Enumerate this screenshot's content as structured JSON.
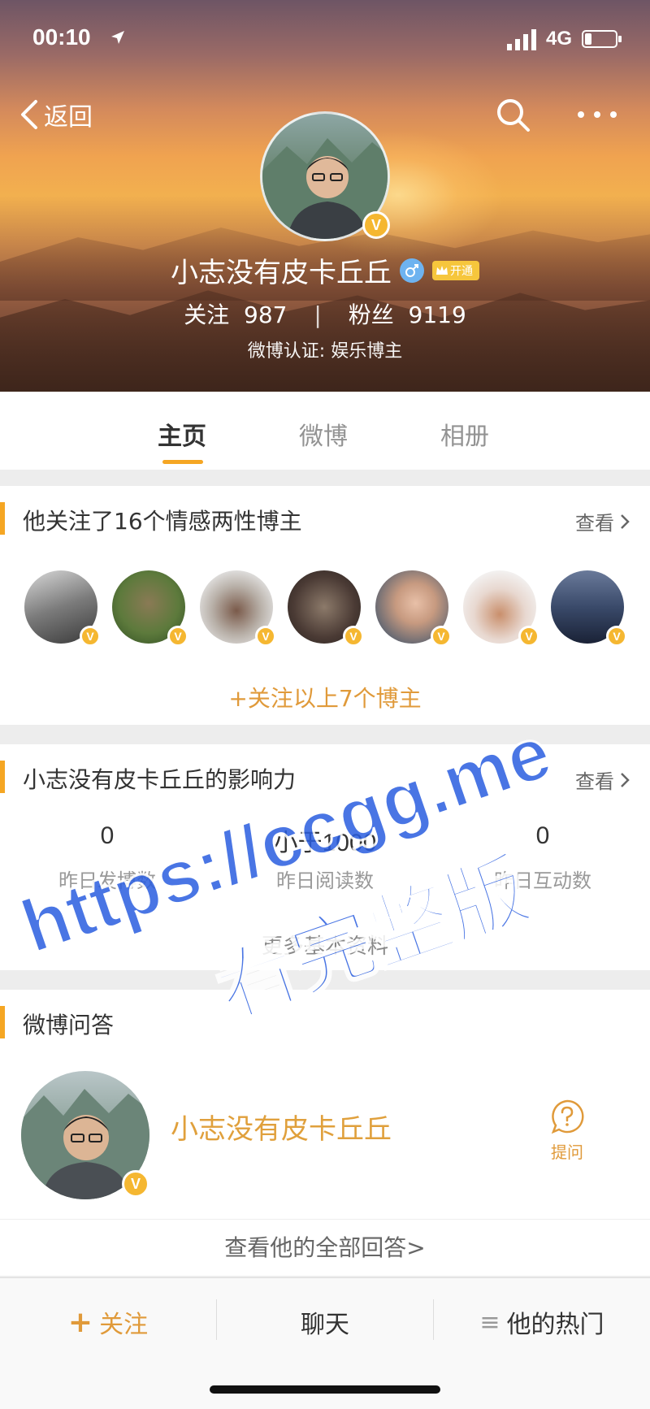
{
  "status_bar": {
    "time": "00:10",
    "network": "4G"
  },
  "nav": {
    "back_label": "返回",
    "search_icon": "search-icon",
    "more_icon": "more-icon"
  },
  "profile": {
    "name": "小志没有皮卡丘丘",
    "vip_label": "开通",
    "following_label": "关注",
    "following_count": "987",
    "fans_label": "粉丝",
    "fans_count": "9119",
    "stats_separator": "|",
    "verification": "微博认证: 娱乐博主",
    "verified_badge": "V"
  },
  "tabs": [
    {
      "label": "主页",
      "active": true
    },
    {
      "label": "微博",
      "active": false
    },
    {
      "label": "相册",
      "active": false
    }
  ],
  "follow_card": {
    "title": "他关注了16个情感两性博主",
    "see_more": "查看",
    "follow_all": "+关注以上7个博主"
  },
  "influence_card": {
    "title": "小志没有皮卡丘丘的影响力",
    "see_more": "查看",
    "metrics": [
      {
        "value": "0",
        "label": "昨日发博数"
      },
      {
        "value": "小于1000",
        "label": "昨日阅读数"
      },
      {
        "value": "0",
        "label": "昨日互动数"
      }
    ],
    "more_info": "更多基本资料"
  },
  "qa_card": {
    "title": "微博问答",
    "name": "小志没有皮卡丘丘",
    "ask_label": "提问",
    "all_answers": "查看他的全部回答>"
  },
  "bottom_bar": {
    "follow": "关注",
    "follow_icon": "+",
    "chat": "聊天",
    "hot": "他的热门",
    "hot_icon": "≡"
  },
  "watermark": {
    "line1": "https://ccgg.me",
    "line2": "看完整版"
  },
  "colors": {
    "accent": "#f5a623",
    "link": "#e09a3a",
    "watermark": "#2a5ee0"
  }
}
